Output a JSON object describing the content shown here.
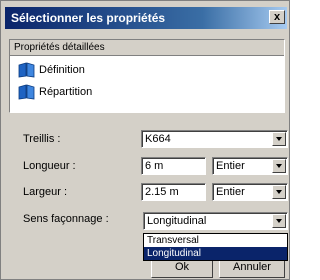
{
  "window": {
    "title": "Sélectionner les propriétés",
    "close_label": "x"
  },
  "properties_panel": {
    "header": "Propriétés détaillées",
    "items": [
      {
        "label": "Définition",
        "icon": "book-icon"
      },
      {
        "label": "Répartition",
        "icon": "book-icon"
      }
    ]
  },
  "fields": {
    "treillis": {
      "label": "Treillis :",
      "value": "K664"
    },
    "longueur": {
      "label": "Longueur :",
      "value": "6 m",
      "unit": "Entier"
    },
    "largeur": {
      "label": "Largeur :",
      "value": "2.15 m",
      "unit": "Entier"
    },
    "sens_faconnage": {
      "label": "Sens façonnage :",
      "value": "Longitudinal",
      "options": [
        "Transversal",
        "Longitudinal"
      ],
      "selected_index": 1
    }
  },
  "buttons": {
    "ok": "Ok",
    "cancel": "Annuler"
  },
  "colors": {
    "title_bar": "#0a246a",
    "selection": "#0a246a",
    "face": "#d4d0c8"
  }
}
